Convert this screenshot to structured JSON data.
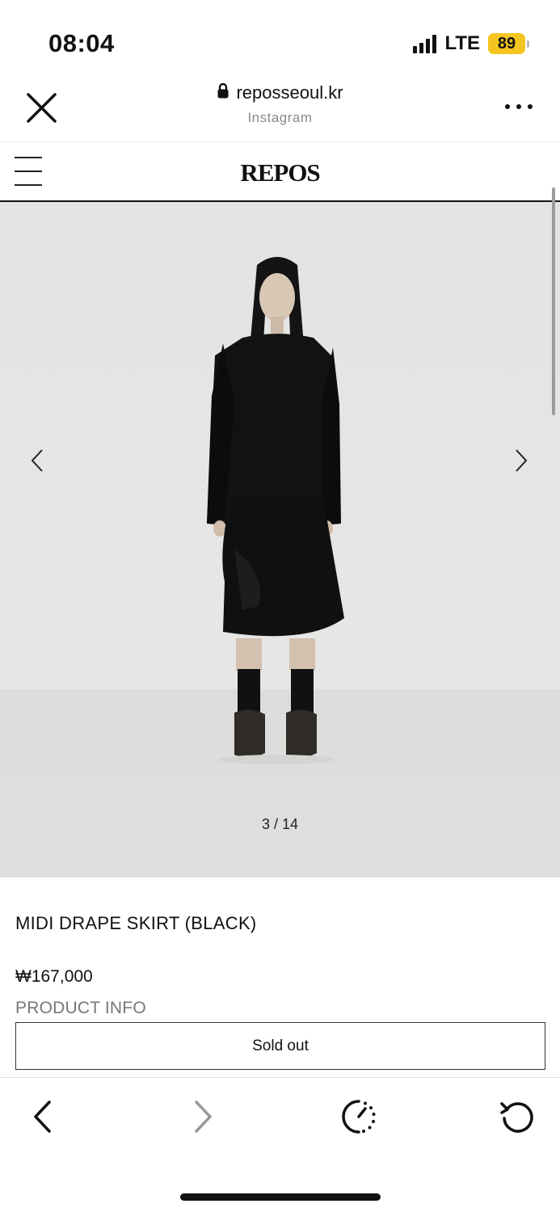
{
  "status_bar": {
    "time": "08:04",
    "network": "LTE",
    "battery": "89"
  },
  "browser": {
    "domain": "reposseoul.kr",
    "source": "Instagram",
    "icons": [
      "close-icon",
      "lock-icon",
      "more-icon"
    ]
  },
  "site": {
    "logo": "REPOS",
    "menu_icon": "hamburger-icon"
  },
  "gallery": {
    "counter": "3 / 14",
    "current": 3,
    "total": 14
  },
  "product": {
    "name": "MIDI DRAPE SKIRT (BLACK)",
    "price": "₩167,000",
    "info_label": "PRODUCT INFO",
    "button_label": "Sold out"
  },
  "toolbar": {
    "icons": [
      "back-icon",
      "forward-icon",
      "speed-icon",
      "reload-icon"
    ]
  },
  "colors": {
    "battery": "#f4c520",
    "background": "#ffffff",
    "photo_bg": "#e4e4e3"
  }
}
